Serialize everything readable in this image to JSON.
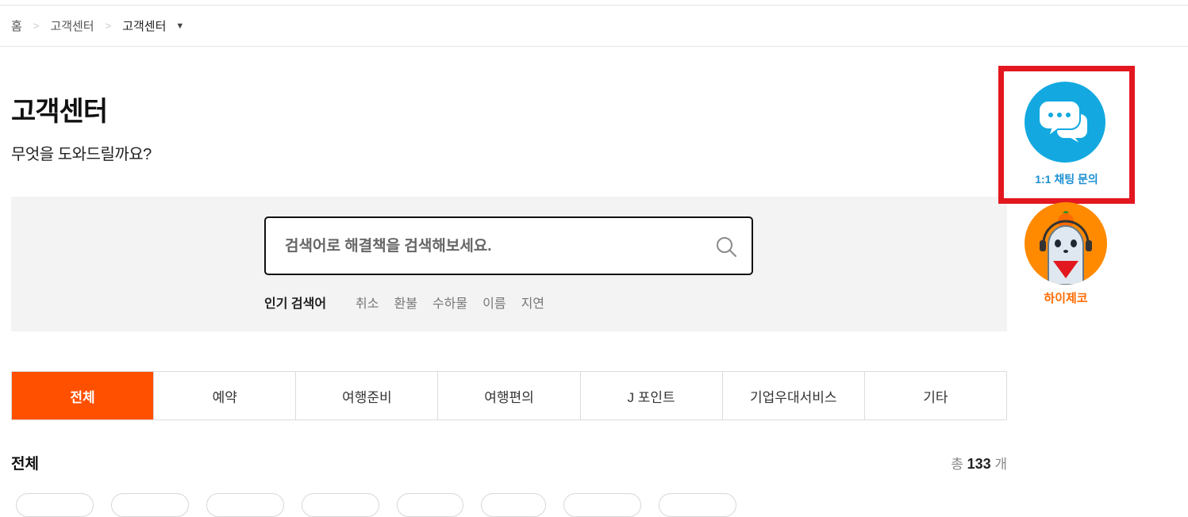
{
  "breadcrumb": {
    "home": "홈",
    "level1": "고객센터",
    "level2": "고객센터"
  },
  "page": {
    "title": "고객센터",
    "subtitle": "무엇을 도와드릴까요?"
  },
  "search": {
    "placeholder": "검색어로 해결책을 검색해보세요.",
    "popular_label": "인기 검색어",
    "keywords": [
      "취소",
      "환불",
      "수하물",
      "이름",
      "지연"
    ]
  },
  "tabs": [
    {
      "label": "전체",
      "active": true
    },
    {
      "label": "예약"
    },
    {
      "label": "여행준비"
    },
    {
      "label": "여행편의"
    },
    {
      "label": "J 포인트"
    },
    {
      "label": "기업우대서비스"
    },
    {
      "label": "기타"
    }
  ],
  "section": {
    "title": "전체",
    "count_prefix": "총",
    "count_value": "133",
    "count_suffix": "개"
  },
  "side": {
    "chat_label": "1:1 채팅 문의",
    "bot_label": "하이제코"
  },
  "colors": {
    "accent": "#ff5000",
    "chat": "#13a9e0",
    "highlight": "#e3171f",
    "bot": "#ff8a00"
  }
}
